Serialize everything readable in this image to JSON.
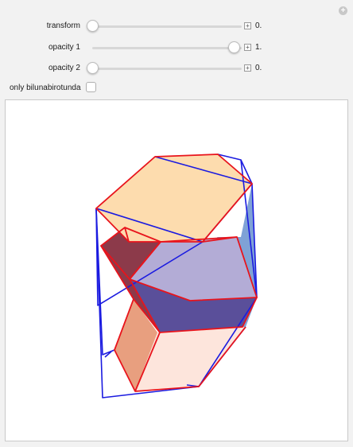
{
  "controls": {
    "sliders": [
      {
        "label": "transform",
        "value_text": "0.",
        "value": 0
      },
      {
        "label": "opacity 1",
        "value_text": "1.",
        "value": 1
      },
      {
        "label": "opacity 2",
        "value_text": "0.",
        "value": 0
      }
    ],
    "checkbox": {
      "label": "only bilunabirotunda",
      "checked": false
    },
    "plus_symbol": "+",
    "corner_symbol": "+"
  },
  "colors": {
    "edge_red": "#e8141c",
    "edge_blue": "#1b1be0",
    "face_peach": "#fddcae",
    "face_slate": "#7e8fc0",
    "face_lavender": "#b3acd6",
    "face_maroon": "#8c3a4a",
    "face_indigo": "#5a4f9a",
    "face_salmon": "#e89f7f",
    "face_pale": "#fde5dc",
    "face_steel": "#7fa2d6"
  }
}
